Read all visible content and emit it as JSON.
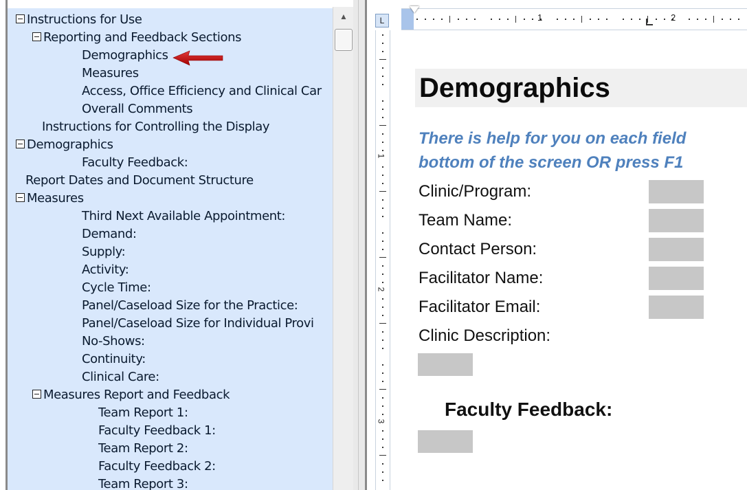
{
  "nav_tree": {
    "items": [
      {
        "label": "Instructions for Use",
        "indent": 0,
        "expander": true
      },
      {
        "label": "Reporting and Feedback Sections",
        "indent": 1,
        "expander": true
      },
      {
        "label": "Demographics",
        "indent": 2,
        "expander": false
      },
      {
        "label": "Measures",
        "indent": 2,
        "expander": false
      },
      {
        "label": "Access, Office Efficiency and Clinical Car",
        "indent": 2,
        "expander": false
      },
      {
        "label": "Overall Comments",
        "indent": 2,
        "expander": false
      },
      {
        "label": "Instructions for Controlling the Display",
        "indent": 1,
        "expander": false
      },
      {
        "label": "Demographics",
        "indent": 0,
        "expander": true
      },
      {
        "label": "Faculty Feedback:",
        "indent": 2,
        "expander": false
      },
      {
        "label": "Report Dates and Document Structure",
        "indent": 0,
        "expander": false
      },
      {
        "label": "Measures",
        "indent": 0,
        "expander": true
      },
      {
        "label": "Third Next Available Appointment:",
        "indent": 2,
        "expander": false
      },
      {
        "label": "Demand:",
        "indent": 2,
        "expander": false
      },
      {
        "label": "Supply:",
        "indent": 2,
        "expander": false
      },
      {
        "label": "Activity:",
        "indent": 2,
        "expander": false
      },
      {
        "label": "Cycle Time:",
        "indent": 2,
        "expander": false
      },
      {
        "label": "Panel/Caseload Size for the Practice:",
        "indent": 2,
        "expander": false
      },
      {
        "label": "Panel/Caseload Size for Individual Provi",
        "indent": 2,
        "expander": false
      },
      {
        "label": "No-Shows:",
        "indent": 2,
        "expander": false
      },
      {
        "label": "Continuity:",
        "indent": 2,
        "expander": false
      },
      {
        "label": "Clinical Care:",
        "indent": 2,
        "expander": false
      },
      {
        "label": "Measures Report and Feedback",
        "indent": 1,
        "expander": true
      },
      {
        "label": "Team Report 1:",
        "indent": 3,
        "expander": false
      },
      {
        "label": "Faculty Feedback 1:",
        "indent": 3,
        "expander": false
      },
      {
        "label": "Team Report 2:",
        "indent": 3,
        "expander": false
      },
      {
        "label": "Faculty Feedback 2:",
        "indent": 3,
        "expander": false
      },
      {
        "label": "Team Report 3:",
        "indent": 3,
        "expander": false
      }
    ]
  },
  "ruler": {
    "tab_selector_glyph": "L",
    "h_numbers": [
      "1",
      "2"
    ],
    "v_numbers": [
      "1",
      "2",
      "3"
    ]
  },
  "document": {
    "heading": "Demographics",
    "help_line1": "There is help for you on each field",
    "help_line2": "bottom of the screen OR press F1",
    "fields": [
      {
        "label": "Clinic/Program:"
      },
      {
        "label": "Team Name:"
      },
      {
        "label": "Contact Person:"
      },
      {
        "label": "Facilitator Name:"
      },
      {
        "label": "Facilitator Email:"
      },
      {
        "label": "Clinic Description:"
      }
    ],
    "faculty_heading": "Faculty Feedback:"
  },
  "colors": {
    "nav_background": "#d9e8fc",
    "help_text": "#4f81bd",
    "field_fill": "#c7c7c7",
    "annotation_arrow": "#c00000"
  },
  "icons": {
    "scroll_up": "scroll-up-arrow-icon",
    "expander": "collapse-box-icon",
    "annotation": "red-arrow-icon"
  }
}
